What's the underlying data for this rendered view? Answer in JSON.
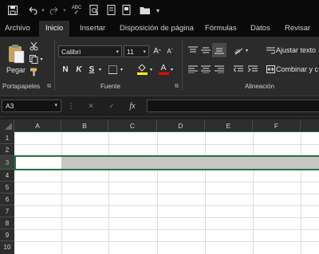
{
  "quick_access": {
    "icons": [
      "save-icon",
      "undo-icon",
      "redo-icon",
      "spellcheck-icon",
      "print-preview-icon",
      "format-painter-icon",
      "open-folder-icon",
      "customize-icon"
    ],
    "spellcheck_text": "ABC"
  },
  "tabs": [
    "Archivo",
    "Inicio",
    "Insertar",
    "Disposición de página",
    "Fórmulas",
    "Datos",
    "Revisar"
  ],
  "active_tab": "Inicio",
  "ribbon": {
    "clipboard": {
      "paste_label": "Pegar",
      "group_label": "Portapapeles"
    },
    "font": {
      "group_label": "Fuente",
      "font_name": "Calibri",
      "font_size": "11",
      "grow_label": "A",
      "shrink_label": "A",
      "bold": "N",
      "italic": "K",
      "underline": "S",
      "fill_color": "#ffff00",
      "font_color": "#ff0000"
    },
    "alignment": {
      "group_label": "Alineación",
      "wrap_text": "Ajustar texto",
      "merge_center": "Combinar y c"
    }
  },
  "formula_bar": {
    "name_box": "A3",
    "fx": "fx",
    "cancel": "✕",
    "enter": "✓",
    "more": "⋮",
    "formula": ""
  },
  "sheet": {
    "columns": [
      "A",
      "B",
      "C",
      "D",
      "E",
      "F"
    ],
    "rows": [
      "1",
      "2",
      "3",
      "4",
      "5",
      "6",
      "7",
      "8",
      "9",
      "10"
    ],
    "active_cell": "A3",
    "selected_row": "3",
    "header_accent": "#217346",
    "selection_fill": "#c6c6c6"
  }
}
